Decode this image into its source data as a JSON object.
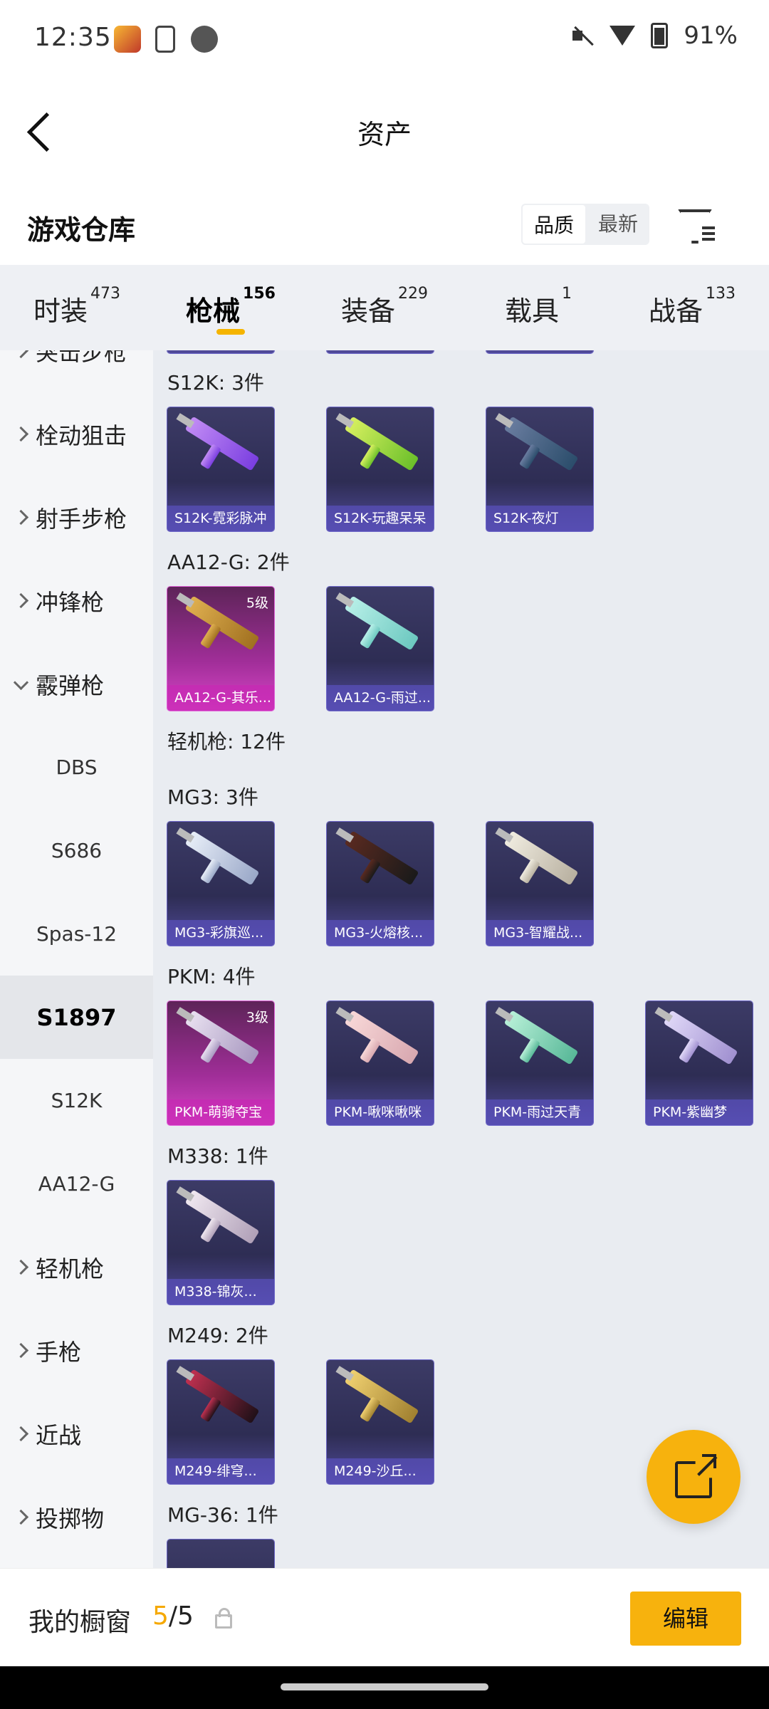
{
  "status": {
    "time": "12:35",
    "battery": "91%"
  },
  "header": {
    "title": "资产"
  },
  "section": {
    "title": "游戏仓库",
    "sort": [
      "品质",
      "最新"
    ]
  },
  "tabs": [
    {
      "label": "时装",
      "count": "473"
    },
    {
      "label": "枪械",
      "count": "156"
    },
    {
      "label": "装备",
      "count": "229"
    },
    {
      "label": "载具",
      "count": "1"
    },
    {
      "label": "战备",
      "count": "133"
    }
  ],
  "sidebar": [
    "突击步枪",
    "栓动狙击",
    "射手步枪",
    "冲锋枪",
    "霰弹枪",
    "DBS",
    "S686",
    "Spas-12",
    "S1897",
    "S12K",
    "AA12-G",
    "轻机枪",
    "手枪",
    "近战",
    "投掷物"
  ],
  "groups": {
    "s12k": "S12K: 3件",
    "aa12": "AA12-G: 2件",
    "lmg": "轻机枪: 12件",
    "mg3": "MG3: 3件",
    "pkm": "PKM: 4件",
    "m338": "M338: 1件",
    "m249": "M249: 2件",
    "mg36": "MG-36: 1件"
  },
  "items": {
    "s12k": [
      "S12K-霓彩脉冲",
      "S12K-玩趣呆呆",
      "S12K-夜灯"
    ],
    "aa12": [
      "AA12-G-其乐...",
      "AA12-G-雨过..."
    ],
    "mg3": [
      "MG3-彩旗巡...",
      "MG3-火熔核...",
      "MG3-智耀战..."
    ],
    "pkm": [
      "PKM-萌骑夺宝",
      "PKM-啾咪啾咪",
      "PKM-雨过天青",
      "PKM-紫幽梦"
    ],
    "m338": [
      "M338-锦灰..."
    ],
    "m249": [
      "M249-绯穹...",
      "M249-沙丘..."
    ]
  },
  "levels": {
    "aa12_0": "5级",
    "pkm_0": "3级"
  },
  "bottom": {
    "label": "我的橱窗",
    "current": "5",
    "total": "/5",
    "edit": "编辑"
  },
  "colors": {
    "accent": "#f7b20d",
    "rare_purple": "#3c3b66",
    "legend_pink": "#a02e98"
  }
}
